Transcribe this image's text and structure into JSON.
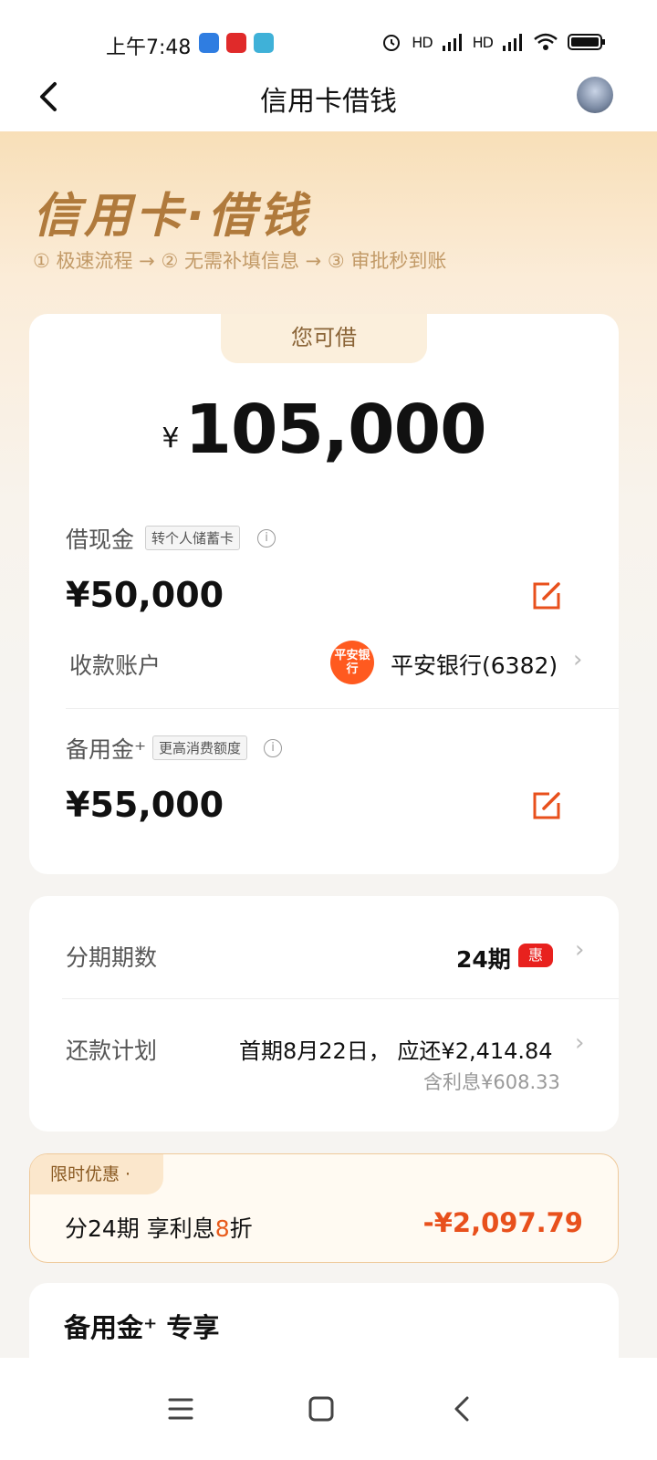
{
  "status": {
    "time": "上午7:48",
    "network_1": "HD",
    "network_2": "HD"
  },
  "nav": {
    "title": "信用卡借钱"
  },
  "hero": {
    "title": "信用卡·借钱",
    "steps": "① 极速流程 → ② 无需补填信息 → ③ 审批秒到账"
  },
  "main_card": {
    "tab_label": "您可借",
    "currency": "¥",
    "total": "105,000",
    "cash": {
      "label": "借现金",
      "tag": "转个人储蓄卡",
      "amount": "¥50,000",
      "account_label": "收款账户",
      "bank_logo_text": "平安银行",
      "bank_name": "平安银行(6382)"
    },
    "reserve": {
      "label": "备用金⁺",
      "tag": "更高消费额度",
      "amount": "¥55,000"
    }
  },
  "install_card": {
    "period_label": "分期期数",
    "period_value": "24期",
    "period_badge": "惠",
    "plan_label": "还款计划",
    "plan_value": "首期8月22日， 应还¥2,414.84",
    "plan_interest": "含利息¥608.33"
  },
  "promo": {
    "tag": "限时优惠 ·",
    "text_prefix": "分24期 享利息",
    "text_highlight": "8",
    "text_suffix": "折",
    "amount": "-¥2,097.79"
  },
  "exclusive": {
    "title": "备用金⁺ 专享"
  },
  "icons": {
    "back": "chevron-left-icon",
    "avatar": "avatar",
    "edit": "edit-icon",
    "info": "info-icon",
    "chevron": "chevron-right-icon",
    "sys_menu": "menu-icon",
    "sys_home": "home-square-icon",
    "sys_back": "back-icon"
  },
  "colors": {
    "accent": "#e8501c",
    "hero_gold": "#b07a3c",
    "badge_red": "#e8211e"
  }
}
